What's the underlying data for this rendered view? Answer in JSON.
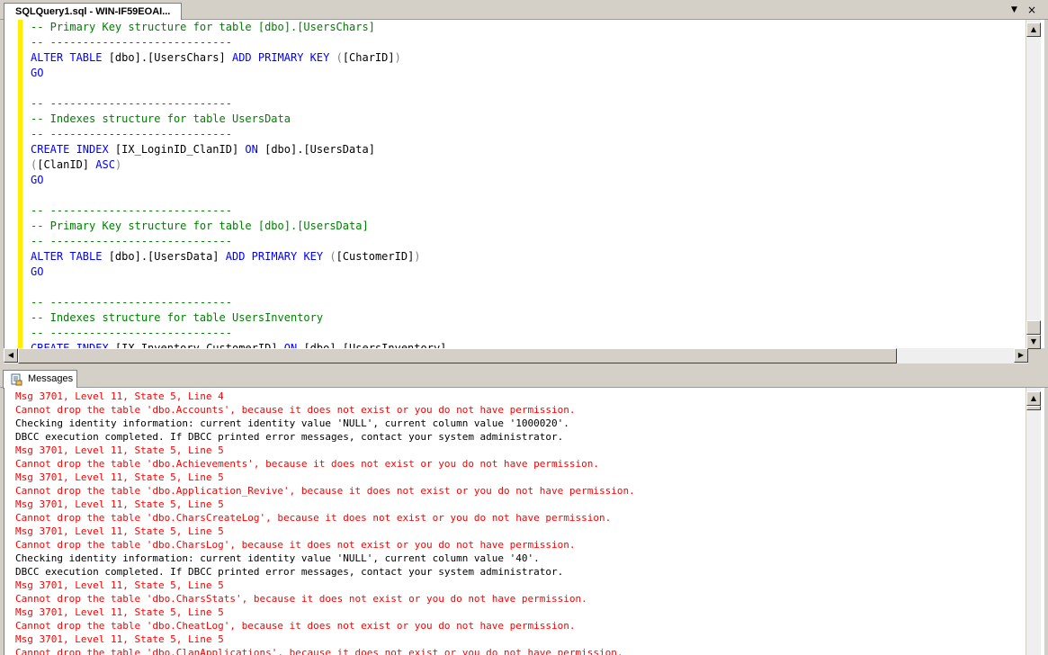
{
  "document_tab": {
    "title": "SQLQuery1.sql - WIN-IF59EOAI..."
  },
  "window_controls": {
    "dropdown": "▼",
    "close": "×"
  },
  "editor": {
    "lines": [
      [
        {
          "t": "-- Primary Key structure for table [dbo].[UsersChars]",
          "c": "c-comment"
        }
      ],
      [
        {
          "t": "-- ----------------------------",
          "c": "c-comment"
        }
      ],
      [
        {
          "t": "ALTER TABLE",
          "c": "kw"
        },
        {
          "t": " [dbo].[UsersChars] ",
          "c": "c-plain"
        },
        {
          "t": "ADD PRIMARY KEY",
          "c": "kw"
        },
        {
          "t": " (",
          "c": "gray"
        },
        {
          "t": "[CharID]",
          "c": "c-plain"
        },
        {
          "t": ")",
          "c": "gray"
        }
      ],
      [
        {
          "t": "GO",
          "c": "kw"
        }
      ],
      [
        {
          "t": "",
          "c": "c-plain"
        }
      ],
      [
        {
          "t": "-- ----------------------------",
          "c": "c-comment"
        }
      ],
      [
        {
          "t": "-- Indexes structure for table UsersData",
          "c": "c-comment"
        }
      ],
      [
        {
          "t": "-- ----------------------------",
          "c": "c-comment"
        }
      ],
      [
        {
          "t": "CREATE INDEX",
          "c": "kw"
        },
        {
          "t": " [IX_LoginID_ClanID] ",
          "c": "c-plain"
        },
        {
          "t": "ON",
          "c": "kw"
        },
        {
          "t": " [dbo].[UsersData]",
          "c": "c-plain"
        }
      ],
      [
        {
          "t": "(",
          "c": "gray"
        },
        {
          "t": "[ClanID] ",
          "c": "c-plain"
        },
        {
          "t": "ASC",
          "c": "kw"
        },
        {
          "t": ")",
          "c": "gray"
        }
      ],
      [
        {
          "t": "GO",
          "c": "kw"
        }
      ],
      [
        {
          "t": "",
          "c": "c-plain"
        }
      ],
      [
        {
          "t": "-- ----------------------------",
          "c": "c-comment"
        }
      ],
      [
        {
          "t": "-- Primary Key structure for table [dbo].[UsersData]",
          "c": "c-comment"
        }
      ],
      [
        {
          "t": "-- ----------------------------",
          "c": "c-comment"
        }
      ],
      [
        {
          "t": "ALTER TABLE",
          "c": "kw"
        },
        {
          "t": " [dbo].[UsersData] ",
          "c": "c-plain"
        },
        {
          "t": "ADD PRIMARY KEY",
          "c": "kw"
        },
        {
          "t": " (",
          "c": "gray"
        },
        {
          "t": "[CustomerID]",
          "c": "c-plain"
        },
        {
          "t": ")",
          "c": "gray"
        }
      ],
      [
        {
          "t": "GO",
          "c": "kw"
        }
      ],
      [
        {
          "t": "",
          "c": "c-plain"
        }
      ],
      [
        {
          "t": "-- ----------------------------",
          "c": "c-comment"
        }
      ],
      [
        {
          "t": "-- Indexes structure for table UsersInventory",
          "c": "c-comment"
        }
      ],
      [
        {
          "t": "-- ----------------------------",
          "c": "c-comment"
        }
      ],
      [
        {
          "t": "CREATE INDEX",
          "c": "kw"
        },
        {
          "t": " [IX_Inventory_CustomerID] ",
          "c": "c-plain"
        },
        {
          "t": "ON",
          "c": "kw"
        },
        {
          "t": " [dbo].[UsersInventory]",
          "c": "c-plain"
        }
      ]
    ]
  },
  "results": {
    "tab_label": "Messages",
    "lines": [
      {
        "text": "Msg 3701, Level 11, State 5, Line 4",
        "kind": "err"
      },
      {
        "text": "Cannot drop the table 'dbo.Accounts', because it does not exist or you do not have permission.",
        "kind": "err"
      },
      {
        "text": "Checking identity information: current identity value 'NULL', current column value '1000020'.",
        "kind": "info"
      },
      {
        "text": "DBCC execution completed. If DBCC printed error messages, contact your system administrator.",
        "kind": "info"
      },
      {
        "text": "Msg 3701, Level 11, State 5, Line 5",
        "kind": "err"
      },
      {
        "text": "Cannot drop the table 'dbo.Achievements', because it does not exist or you do not have permission.",
        "kind": "err"
      },
      {
        "text": "Msg 3701, Level 11, State 5, Line 5",
        "kind": "err"
      },
      {
        "text": "Cannot drop the table 'dbo.Application_Revive', because it does not exist or you do not have permission.",
        "kind": "err"
      },
      {
        "text": "Msg 3701, Level 11, State 5, Line 5",
        "kind": "err"
      },
      {
        "text": "Cannot drop the table 'dbo.CharsCreateLog', because it does not exist or you do not have permission.",
        "kind": "err"
      },
      {
        "text": "Msg 3701, Level 11, State 5, Line 5",
        "kind": "err"
      },
      {
        "text": "Cannot drop the table 'dbo.CharsLog', because it does not exist or you do not have permission.",
        "kind": "err"
      },
      {
        "text": "Checking identity information: current identity value 'NULL', current column value '40'.",
        "kind": "info"
      },
      {
        "text": "DBCC execution completed. If DBCC printed error messages, contact your system administrator.",
        "kind": "info"
      },
      {
        "text": "Msg 3701, Level 11, State 5, Line 5",
        "kind": "err"
      },
      {
        "text": "Cannot drop the table 'dbo.CharsStats', because it does not exist or you do not have permission.",
        "kind": "err"
      },
      {
        "text": "Msg 3701, Level 11, State 5, Line 5",
        "kind": "err"
      },
      {
        "text": "Cannot drop the table 'dbo.CheatLog', because it does not exist or you do not have permission.",
        "kind": "err"
      },
      {
        "text": "Msg 3701, Level 11, State 5, Line 5",
        "kind": "err"
      },
      {
        "text": "Cannot drop the table 'dbo.ClanApplications', because it does not exist or you do not have permission.",
        "kind": "err"
      }
    ]
  },
  "colors": {
    "comment": "#008000",
    "keyword": "#0000ff",
    "error": "#ff0000",
    "change_bar": "#ffee00"
  },
  "icons": {
    "messages_tab": "messages-icon",
    "scroll_up": "▲",
    "scroll_down": "▼",
    "scroll_left": "◀",
    "scroll_right": "▶"
  }
}
